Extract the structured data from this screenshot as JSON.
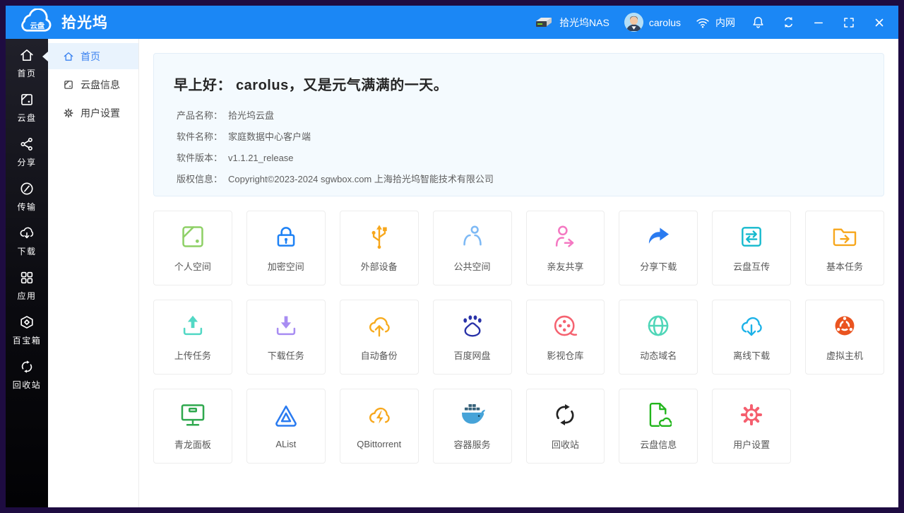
{
  "titlebar": {
    "logo_product": "云盘",
    "logo_brand": "拾光坞",
    "nas_label": "拾光坞NAS",
    "username": "carolus",
    "network_label": "内网",
    "accent_color": "#1b87f5",
    "controls": [
      "bell-icon",
      "refresh-icon",
      "minimize-icon",
      "maximize-icon",
      "close-icon"
    ]
  },
  "sidebar": {
    "items": [
      {
        "label": "首页",
        "icon": "home-icon",
        "active": true
      },
      {
        "label": "云盘",
        "icon": "disk-icon",
        "active": false
      },
      {
        "label": "分享",
        "icon": "share-icon",
        "active": false
      },
      {
        "label": "传输",
        "icon": "transfer-icon",
        "active": false
      },
      {
        "label": "下载",
        "icon": "cloud-download-icon",
        "active": false
      },
      {
        "label": "应用",
        "icon": "apps-icon",
        "active": false
      },
      {
        "label": "百宝箱",
        "icon": "toolbox-icon",
        "active": false
      },
      {
        "label": "回收站",
        "icon": "recycle-icon",
        "active": false
      }
    ]
  },
  "submenu": {
    "items": [
      {
        "label": "首页",
        "icon": "home-icon",
        "active": true
      },
      {
        "label": "云盘信息",
        "icon": "disk-info-icon",
        "active": false
      },
      {
        "label": "用户设置",
        "icon": "settings-icon",
        "active": false
      }
    ]
  },
  "greeting": {
    "title": "早上好： carolus，又是元气满满的一天。",
    "info": [
      {
        "label": "产品名称：",
        "value": "拾光坞云盘"
      },
      {
        "label": "软件名称：",
        "value": "家庭数据中心客户端"
      },
      {
        "label": "软件版本：",
        "value": "v1.1.21_release"
      },
      {
        "label": "版权信息：",
        "value": "Copyright©2023-2024 sgwbox.com 上海拾光坞智能技术有限公司"
      }
    ]
  },
  "tiles": [
    {
      "label": "个人空间",
      "icon": "personal-space-icon",
      "color": "#8ed066"
    },
    {
      "label": "加密空间",
      "icon": "lock-icon",
      "color": "#1e82f5"
    },
    {
      "label": "外部设备",
      "icon": "usb-icon",
      "color": "#f7a71c"
    },
    {
      "label": "公共空间",
      "icon": "public-space-icon",
      "color": "#7db9f5"
    },
    {
      "label": "亲友共享",
      "icon": "friend-share-icon",
      "color": "#f478c2"
    },
    {
      "label": "分享下载",
      "icon": "share-download-icon",
      "color": "#2a7bf0"
    },
    {
      "label": "云盘互传",
      "icon": "cloud-transfer-icon",
      "color": "#14b9cd"
    },
    {
      "label": "基本任务",
      "icon": "task-folder-icon",
      "color": "#f7a71c"
    },
    {
      "label": "上传任务",
      "icon": "upload-icon",
      "color": "#52d8c5"
    },
    {
      "label": "下载任务",
      "icon": "download-icon",
      "color": "#a88df2"
    },
    {
      "label": "自动备份",
      "icon": "cloud-backup-icon",
      "color": "#f7ab1e"
    },
    {
      "label": "百度网盘",
      "icon": "baidu-paw-icon",
      "color": "#2932a8"
    },
    {
      "label": "影视仓库",
      "icon": "film-reel-icon",
      "color": "#f56270"
    },
    {
      "label": "动态域名",
      "icon": "globe-icon",
      "color": "#4fd6b8"
    },
    {
      "label": "离线下载",
      "icon": "cloud-download-icon",
      "color": "#1cb2e8"
    },
    {
      "label": "虚拟主机",
      "icon": "ubuntu-icon",
      "color": "#ea5420"
    },
    {
      "label": "青龙面板",
      "icon": "monitor-icon",
      "color": "#2fa84e"
    },
    {
      "label": "AList",
      "icon": "alist-icon",
      "color": "#2a7bf0"
    },
    {
      "label": "QBittorrent",
      "icon": "qbittorrent-icon",
      "color": "#f7a71c"
    },
    {
      "label": "容器服务",
      "icon": "docker-icon",
      "color": "#46a3d8"
    },
    {
      "label": "回收站",
      "icon": "recycle-icon",
      "color": "#222222"
    },
    {
      "label": "云盘信息",
      "icon": "doc-cloud-icon",
      "color": "#22b51c"
    },
    {
      "label": "用户设置",
      "icon": "gear-icon",
      "color": "#f55f6f"
    }
  ]
}
